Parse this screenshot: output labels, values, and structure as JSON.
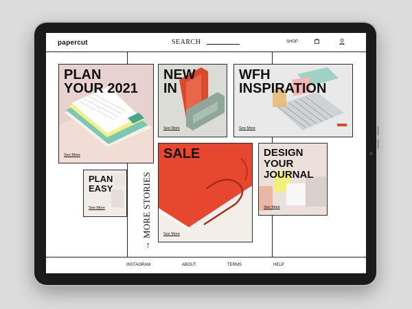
{
  "header": {
    "logo": "papercut",
    "search_label": "SEARCH",
    "shop_label": "SHOP",
    "cart_icon": "bag-icon",
    "account_icon": "user-icon"
  },
  "cards": {
    "plan2021": {
      "title_line1": "PLAN",
      "title_line2": "YOUR 2021",
      "link": "See More"
    },
    "newin": {
      "title_line1": "NEW",
      "title_line2": "IN",
      "link": "See More"
    },
    "wfh": {
      "title_line1": "WFH",
      "title_line2": "INSPIRATION",
      "link": "See More"
    },
    "sale": {
      "title": "SALE",
      "link": "See More"
    },
    "design": {
      "title_line1": "DESIGN",
      "title_line2": "YOUR",
      "title_line3": "JOURNAL",
      "link": "See More"
    },
    "planeasy": {
      "title_line1": "PLAN",
      "title_line2": "EASY",
      "link": "See More"
    }
  },
  "more_stories": {
    "label": "MORE STORIES",
    "arrow": "→"
  },
  "footer": {
    "links": [
      "INSTAGRAM",
      "ABOUT",
      "TERMS",
      "HELP"
    ]
  },
  "colors": {
    "accent_red": "#e8472f",
    "card_pink": "#eacfcd",
    "card_beige": "#e9dfd8"
  }
}
